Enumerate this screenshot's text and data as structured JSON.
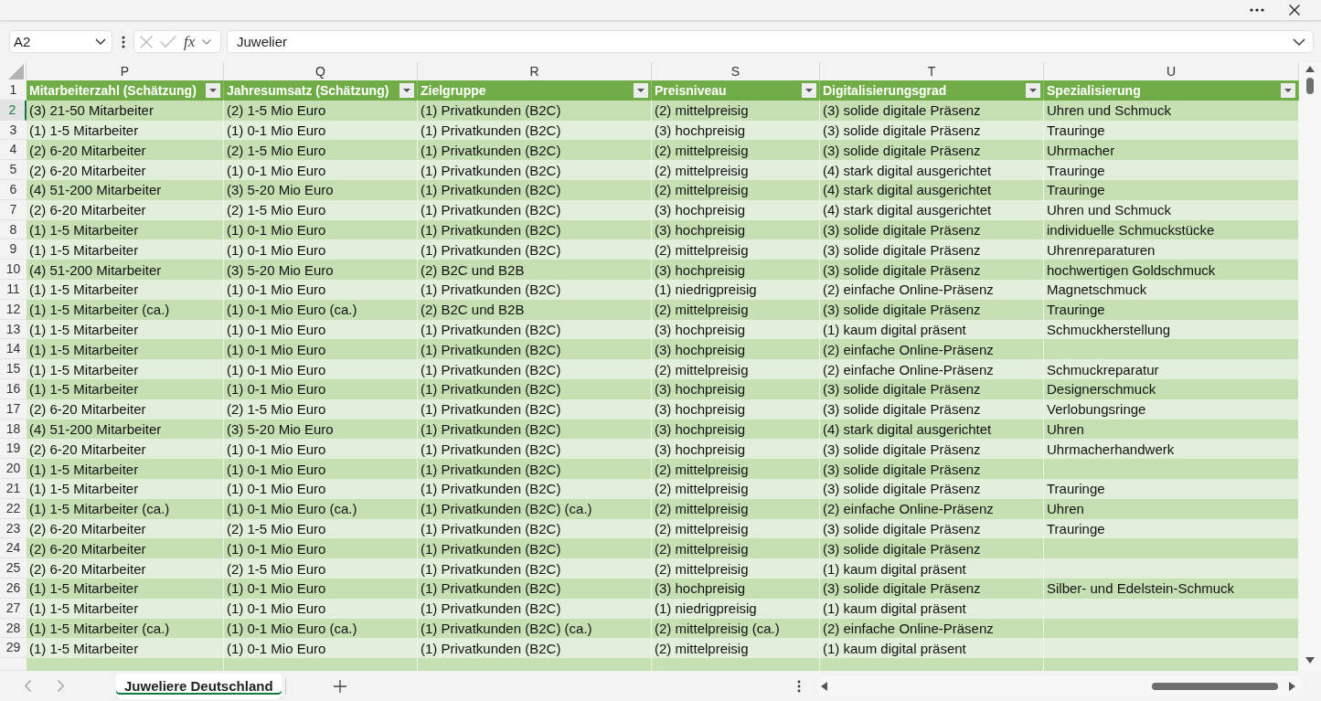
{
  "formula_bar": {
    "name_box": "A2",
    "function_label": "fx",
    "formula": "Juwelier"
  },
  "sheet": {
    "column_letters": [
      "P",
      "Q",
      "R",
      "S",
      "T",
      "U"
    ],
    "header_row_number": "1",
    "headers": [
      "Mitarbeiterzahl (Schätzung)",
      "Jahresumsatz (Schätzung)",
      "Zielgruppe",
      "Preisniveau",
      "Digitalisierungsgrad",
      "Spezialisierung"
    ],
    "rows": [
      {
        "number": "2",
        "selected": true,
        "cells": [
          "(3) 21-50 Mitarbeiter",
          "(2) 1-5 Mio Euro",
          "(1) Privatkunden (B2C)",
          "(2) mittelpreisig",
          "(3) solide digitale Präsenz",
          "Uhren und Schmuck"
        ]
      },
      {
        "number": "3",
        "selected": false,
        "cells": [
          "(1) 1-5 Mitarbeiter",
          "(1) 0-1 Mio Euro",
          "(1) Privatkunden (B2C)",
          "(3) hochpreisig",
          "(3) solide digitale Präsenz",
          "Trauringe"
        ]
      },
      {
        "number": "4",
        "selected": false,
        "cells": [
          "(2) 6-20 Mitarbeiter",
          "(2) 1-5 Mio Euro",
          "(1) Privatkunden (B2C)",
          "(2) mittelpreisig",
          "(3) solide digitale Präsenz",
          "Uhrmacher"
        ]
      },
      {
        "number": "5",
        "selected": false,
        "cells": [
          "(2) 6-20 Mitarbeiter",
          "(1) 0-1 Mio Euro",
          "(1) Privatkunden (B2C)",
          "(2) mittelpreisig",
          "(4) stark digital ausgerichtet",
          "Trauringe"
        ]
      },
      {
        "number": "6",
        "selected": false,
        "cells": [
          "(4) 51-200 Mitarbeiter",
          "(3) 5-20 Mio Euro",
          "(1) Privatkunden (B2C)",
          "(2) mittelpreisig",
          "(4) stark digital ausgerichtet",
          "Trauringe"
        ]
      },
      {
        "number": "7",
        "selected": false,
        "cells": [
          "(2) 6-20 Mitarbeiter",
          "(2) 1-5 Mio Euro",
          "(1) Privatkunden (B2C)",
          "(3) hochpreisig",
          "(4) stark digital ausgerichtet",
          "Uhren und Schmuck"
        ]
      },
      {
        "number": "8",
        "selected": false,
        "cells": [
          "(1) 1-5 Mitarbeiter",
          "(1) 0-1 Mio Euro",
          "(1) Privatkunden (B2C)",
          "(3) hochpreisig",
          "(3) solide digitale Präsenz",
          "individuelle Schmuckstücke"
        ]
      },
      {
        "number": "9",
        "selected": false,
        "cells": [
          "(1) 1-5 Mitarbeiter",
          "(1) 0-1 Mio Euro",
          "(1) Privatkunden (B2C)",
          "(2) mittelpreisig",
          "(3) solide digitale Präsenz",
          "Uhrenreparaturen"
        ]
      },
      {
        "number": "10",
        "selected": false,
        "cells": [
          "(4) 51-200 Mitarbeiter",
          "(3) 5-20 Mio Euro",
          "(2) B2C und B2B",
          "(3) hochpreisig",
          "(3) solide digitale Präsenz",
          "hochwertigen Goldschmuck"
        ]
      },
      {
        "number": "11",
        "selected": false,
        "cells": [
          "(1) 1-5 Mitarbeiter",
          "(1) 0-1 Mio Euro",
          "(1) Privatkunden (B2C)",
          "(1) niedrigpreisig",
          "(2) einfache Online-Präsenz",
          "Magnetschmuck"
        ]
      },
      {
        "number": "12",
        "selected": false,
        "cells": [
          "(1) 1-5 Mitarbeiter (ca.)",
          "(1) 0-1 Mio Euro (ca.)",
          "(2) B2C und B2B",
          "(2) mittelpreisig",
          "(3) solide digitale Präsenz",
          "Trauringe"
        ]
      },
      {
        "number": "13",
        "selected": false,
        "cells": [
          "(1) 1-5 Mitarbeiter",
          "(1) 0-1 Mio Euro",
          "(1) Privatkunden (B2C)",
          "(3) hochpreisig",
          "(1) kaum digital präsent",
          "Schmuckherstellung"
        ]
      },
      {
        "number": "14",
        "selected": false,
        "cells": [
          "(1) 1-5 Mitarbeiter",
          "(1) 0-1 Mio Euro",
          "(1) Privatkunden (B2C)",
          "(3) hochpreisig",
          "(2) einfache Online-Präsenz"
        ]
      },
      {
        "number": "15",
        "selected": false,
        "cells": [
          "(1) 1-5 Mitarbeiter",
          "(1) 0-1 Mio Euro",
          "(1) Privatkunden (B2C)",
          "(2) mittelpreisig",
          "(2) einfache Online-Präsenz",
          "Schmuckreparatur"
        ]
      },
      {
        "number": "16",
        "selected": false,
        "cells": [
          "(1) 1-5 Mitarbeiter",
          "(1) 0-1 Mio Euro",
          "(1) Privatkunden (B2C)",
          "(3) hochpreisig",
          "(3) solide digitale Präsenz",
          "Designerschmuck"
        ]
      },
      {
        "number": "17",
        "selected": false,
        "cells": [
          "(2) 6-20 Mitarbeiter",
          "(2) 1-5 Mio Euro",
          "(1) Privatkunden (B2C)",
          "(3) hochpreisig",
          "(3) solide digitale Präsenz",
          "Verlobungsringe"
        ]
      },
      {
        "number": "18",
        "selected": false,
        "cells": [
          "(4) 51-200 Mitarbeiter",
          "(3) 5-20 Mio Euro",
          "(1) Privatkunden (B2C)",
          "(3) hochpreisig",
          "(4) stark digital ausgerichtet",
          "Uhren"
        ]
      },
      {
        "number": "19",
        "selected": false,
        "cells": [
          "(2) 6-20 Mitarbeiter",
          "(1) 0-1 Mio Euro",
          "(1) Privatkunden (B2C)",
          "(3) hochpreisig",
          "(3) solide digitale Präsenz",
          "Uhrmacherhandwerk"
        ]
      },
      {
        "number": "20",
        "selected": false,
        "cells": [
          "(1) 1-5 Mitarbeiter",
          "(1) 0-1 Mio Euro",
          "(1) Privatkunden (B2C)",
          "(2) mittelpreisig",
          "(3) solide digitale Präsenz"
        ]
      },
      {
        "number": "21",
        "selected": false,
        "cells": [
          "(1) 1-5 Mitarbeiter",
          "(1) 0-1 Mio Euro",
          "(1) Privatkunden (B2C)",
          "(2) mittelpreisig",
          "(3) solide digitale Präsenz",
          "Trauringe"
        ]
      },
      {
        "number": "22",
        "selected": false,
        "cells": [
          "(1) 1-5 Mitarbeiter (ca.)",
          "(1) 0-1 Mio Euro (ca.)",
          "(1) Privatkunden (B2C) (ca.)",
          "(2) mittelpreisig",
          "(2) einfache Online-Präsenz",
          "Uhren"
        ]
      },
      {
        "number": "23",
        "selected": false,
        "cells": [
          "(2) 6-20 Mitarbeiter",
          "(2) 1-5 Mio Euro",
          "(1) Privatkunden (B2C)",
          "(2) mittelpreisig",
          "(3) solide digitale Präsenz",
          "Trauringe"
        ]
      },
      {
        "number": "24",
        "selected": false,
        "cells": [
          "(2) 6-20 Mitarbeiter",
          "(1) 0-1 Mio Euro",
          "(1) Privatkunden (B2C)",
          "(2) mittelpreisig",
          "(3) solide digitale Präsenz"
        ]
      },
      {
        "number": "25",
        "selected": false,
        "cells": [
          "(2) 6-20 Mitarbeiter",
          "(2) 1-5 Mio Euro",
          "(1) Privatkunden (B2C)",
          "(2) mittelpreisig",
          "(1) kaum digital präsent"
        ]
      },
      {
        "number": "26",
        "selected": false,
        "cells": [
          "(1) 1-5 Mitarbeiter",
          "(1) 0-1 Mio Euro",
          "(1) Privatkunden (B2C)",
          "(3) hochpreisig",
          "(3) solide digitale Präsenz",
          "Silber- und Edelstein-Schmuck"
        ]
      },
      {
        "number": "27",
        "selected": false,
        "cells": [
          "(1) 1-5 Mitarbeiter",
          "(1) 0-1 Mio Euro",
          "(1) Privatkunden (B2C)",
          "(1) niedrigpreisig",
          "(1) kaum digital präsent"
        ]
      },
      {
        "number": "28",
        "selected": false,
        "cells": [
          "(1) 1-5 Mitarbeiter (ca.)",
          "(1) 0-1 Mio Euro (ca.)",
          "(1) Privatkunden (B2C) (ca.)",
          "(2) mittelpreisig (ca.)",
          "(2) einfache Online-Präsenz"
        ]
      },
      {
        "number": "29",
        "selected": false,
        "cells": [
          "(1) 1-5 Mitarbeiter",
          "(1) 0-1 Mio Euro",
          "(1) Privatkunden (B2C)",
          "(2) mittelpreisig",
          "(1) kaum digital präsent"
        ]
      }
    ]
  },
  "sheet_tabs": [
    {
      "label": "Juweliere Deutschland",
      "selected": true
    }
  ]
}
